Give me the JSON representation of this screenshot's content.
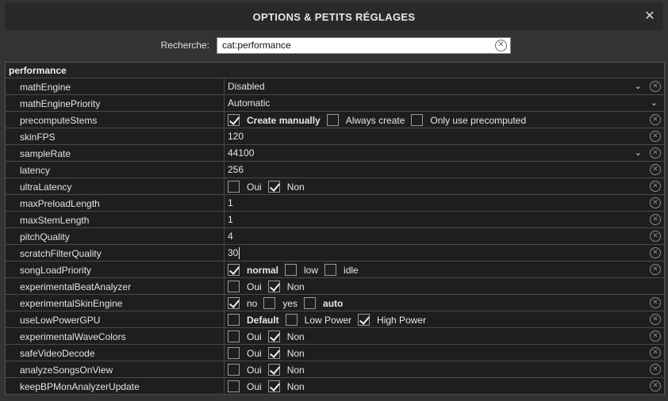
{
  "window": {
    "title": "OPTIONS & PETITS RÉGLAGES",
    "close_icon": "close-icon"
  },
  "search": {
    "label": "Recherche:",
    "value": "cat:performance"
  },
  "section": {
    "title": "performance"
  },
  "rows": [
    {
      "name": "mathEngine",
      "type": "select",
      "value": "Disabled",
      "clear": true
    },
    {
      "name": "mathEnginePriority",
      "type": "select",
      "value": "Automatic",
      "clear": false
    },
    {
      "name": "precomputeStems",
      "type": "options",
      "clear": true,
      "options": [
        {
          "label": "Create manually",
          "checked": true,
          "bold": true
        },
        {
          "label": "Always create",
          "checked": false,
          "bold": false
        },
        {
          "label": "Only use precomputed",
          "checked": false,
          "bold": false
        }
      ]
    },
    {
      "name": "skinFPS",
      "type": "text",
      "value": "120",
      "clear": true
    },
    {
      "name": "sampleRate",
      "type": "select",
      "value": "44100",
      "clear": true
    },
    {
      "name": "latency",
      "type": "text",
      "value": "256",
      "clear": true
    },
    {
      "name": "ultraLatency",
      "type": "options",
      "clear": true,
      "options": [
        {
          "label": "Oui",
          "checked": false,
          "bold": false
        },
        {
          "label": "Non",
          "checked": true,
          "bold": false
        }
      ]
    },
    {
      "name": "maxPreloadLength",
      "type": "text",
      "value": "1",
      "clear": true
    },
    {
      "name": "maxStemLength",
      "type": "text",
      "value": "1",
      "clear": true
    },
    {
      "name": "pitchQuality",
      "type": "text",
      "value": "4",
      "clear": true
    },
    {
      "name": "scratchFilterQuality",
      "type": "text",
      "value": "30",
      "clear": true,
      "caret": true
    },
    {
      "name": "songLoadPriority",
      "type": "options",
      "clear": true,
      "options": [
        {
          "label": "normal",
          "checked": true,
          "bold": true
        },
        {
          "label": "low",
          "checked": false,
          "bold": false
        },
        {
          "label": "idle",
          "checked": false,
          "bold": false
        }
      ]
    },
    {
      "name": "experimentalBeatAnalyzer",
      "type": "options",
      "clear": false,
      "options": [
        {
          "label": "Oui",
          "checked": false,
          "bold": false
        },
        {
          "label": "Non",
          "checked": true,
          "bold": false
        }
      ]
    },
    {
      "name": "experimentalSkinEngine",
      "type": "options",
      "clear": true,
      "options": [
        {
          "label": "no",
          "checked": true,
          "bold": false
        },
        {
          "label": "yes",
          "checked": false,
          "bold": false
        },
        {
          "label": "auto",
          "checked": false,
          "bold": true
        }
      ]
    },
    {
      "name": "useLowPowerGPU",
      "type": "options",
      "clear": true,
      "options": [
        {
          "label": "Default",
          "checked": false,
          "bold": true
        },
        {
          "label": "Low Power",
          "checked": false,
          "bold": false
        },
        {
          "label": "High Power",
          "checked": true,
          "bold": false
        }
      ]
    },
    {
      "name": "experimentalWaveColors",
      "type": "options",
      "clear": true,
      "options": [
        {
          "label": "Oui",
          "checked": false,
          "bold": false
        },
        {
          "label": "Non",
          "checked": true,
          "bold": false
        }
      ]
    },
    {
      "name": "safeVideoDecode",
      "type": "options",
      "clear": true,
      "options": [
        {
          "label": "Oui",
          "checked": false,
          "bold": false
        },
        {
          "label": "Non",
          "checked": true,
          "bold": false
        }
      ]
    },
    {
      "name": "analyzeSongsOnView",
      "type": "options",
      "clear": true,
      "options": [
        {
          "label": "Oui",
          "checked": false,
          "bold": false
        },
        {
          "label": "Non",
          "checked": true,
          "bold": false
        }
      ]
    },
    {
      "name": "keepBPMonAnalyzerUpdate",
      "type": "options",
      "clear": true,
      "options": [
        {
          "label": "Oui",
          "checked": false,
          "bold": false
        },
        {
          "label": "Non",
          "checked": true,
          "bold": false
        }
      ]
    }
  ]
}
